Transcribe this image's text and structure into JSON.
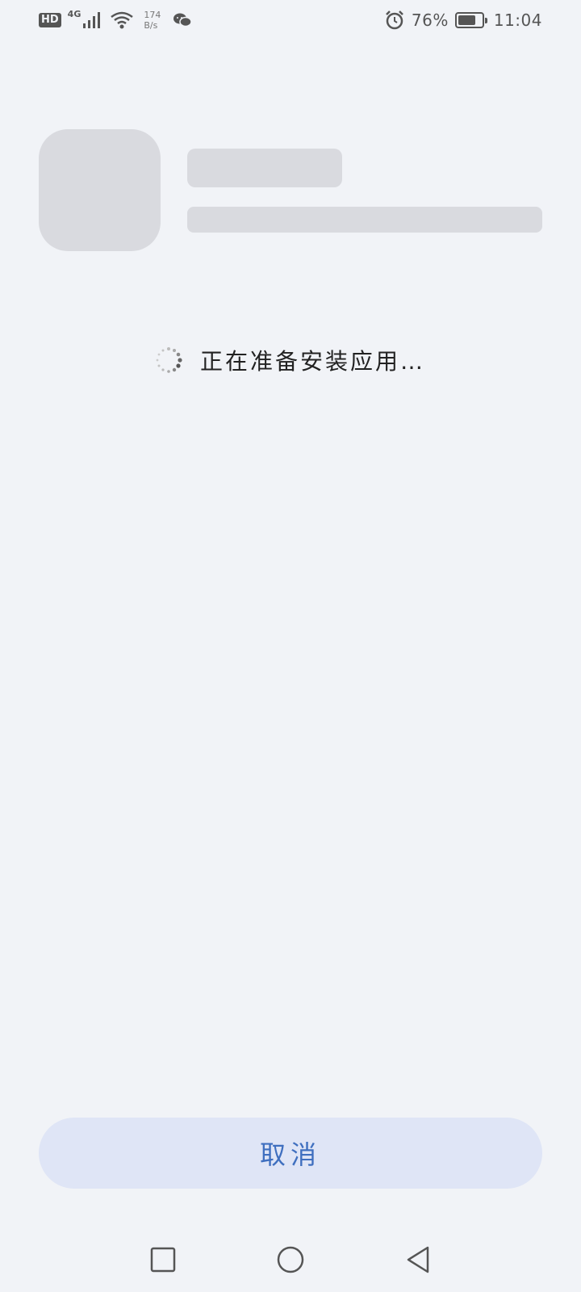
{
  "status_bar": {
    "hd_label": "HD",
    "network_type": "4G",
    "speed_value": "174",
    "speed_unit": "B/s",
    "battery_percent": "76%",
    "battery_level": 0.76,
    "time": "11:04",
    "icons": [
      "signal-icon",
      "wifi-icon",
      "wechat-icon",
      "alarm-icon",
      "battery-icon"
    ]
  },
  "loading": {
    "message": "正在准备安装应用…"
  },
  "actions": {
    "cancel_label": "取消"
  },
  "nav_bar": {
    "icons": [
      "recents-icon",
      "home-icon",
      "back-icon"
    ]
  },
  "colors": {
    "background": "#f1f3f7",
    "skeleton": "#d9dadf",
    "button_bg": "#dfe5f6",
    "accent": "#3f6fbf"
  }
}
